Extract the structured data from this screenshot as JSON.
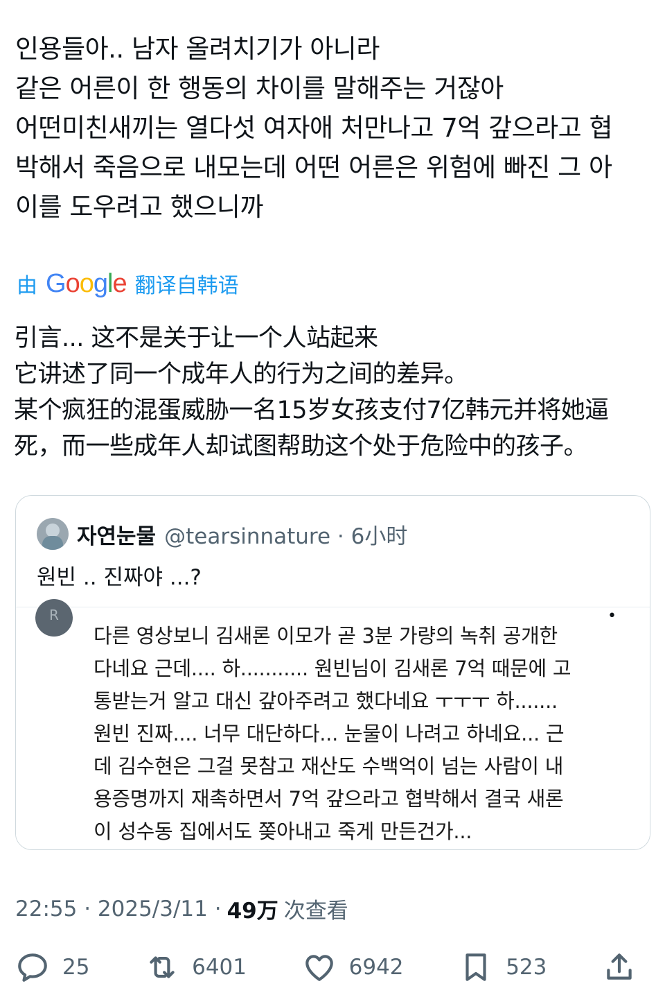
{
  "tweet": {
    "korean_lines": [
      "인용들아.. 남자 올려치기가 아니라",
      "같은 어른이 한 행동의 차이를 말해주는 거잖아",
      "어떤미친새끼는 열다섯 여자애 처만나고 7억 갚으라고 협",
      "박해서 죽음으로 내모는데 어떤 어른은 위험에 빠진 그 아",
      "이를 도우려고 했으니까"
    ],
    "translation": {
      "by": "由",
      "brand": "Google",
      "source": "翻译自韩语"
    },
    "chinese_lines": [
      "引言... 这不是关于让一个人站起来",
      "它讲述了同一个成年人的行为之间的差异。",
      "某个疯狂的混蛋威胁一名15岁女孩支付7亿韩元并将她逼",
      "死，而一些成年人却试图帮助这个处于危险中的孩子。"
    ]
  },
  "quote": {
    "name": "자연눈물",
    "handle_time": "@tearsinnature · 6小时",
    "text": "원빈 .. 진짜야 ...?",
    "embed_avatar": "R",
    "embed_more": "•",
    "embed_lines": [
      "다른 영상보니 김새론 이모가 곧 3분 가량의 녹취 공개한",
      "다네요 근데.... 하........... 원빈님이 김새론 7억 때문에 고",
      "통받는거 알고 대신 갚아주려고 했다네요 ㅜㅜㅜ 하.......",
      "원빈 진짜.... 너무 대단하다... 눈물이 나려고 하네요... 근",
      "데 김수현은 그걸 못참고 재산도 수백억이 넘는 사람이 내",
      "용증명까지 재촉하면서 7억 갚으라고 협박해서 결국 새론",
      "이 성수동 집에서도 쫒아내고 죽게 만든건가..."
    ]
  },
  "meta": {
    "time_date": "22:55 · 2025/3/11 ·",
    "views": "49万",
    "views_label": "次查看"
  },
  "actions": {
    "replies": "25",
    "retweets": "6401",
    "likes": "6942",
    "bookmarks": "523"
  },
  "icons": [
    "reply-icon",
    "retweet-icon",
    "like-icon",
    "bookmark-icon",
    "share-icon"
  ],
  "colors": {
    "link": "#1d9bf0",
    "muted": "#536471",
    "text": "#0f1419"
  }
}
